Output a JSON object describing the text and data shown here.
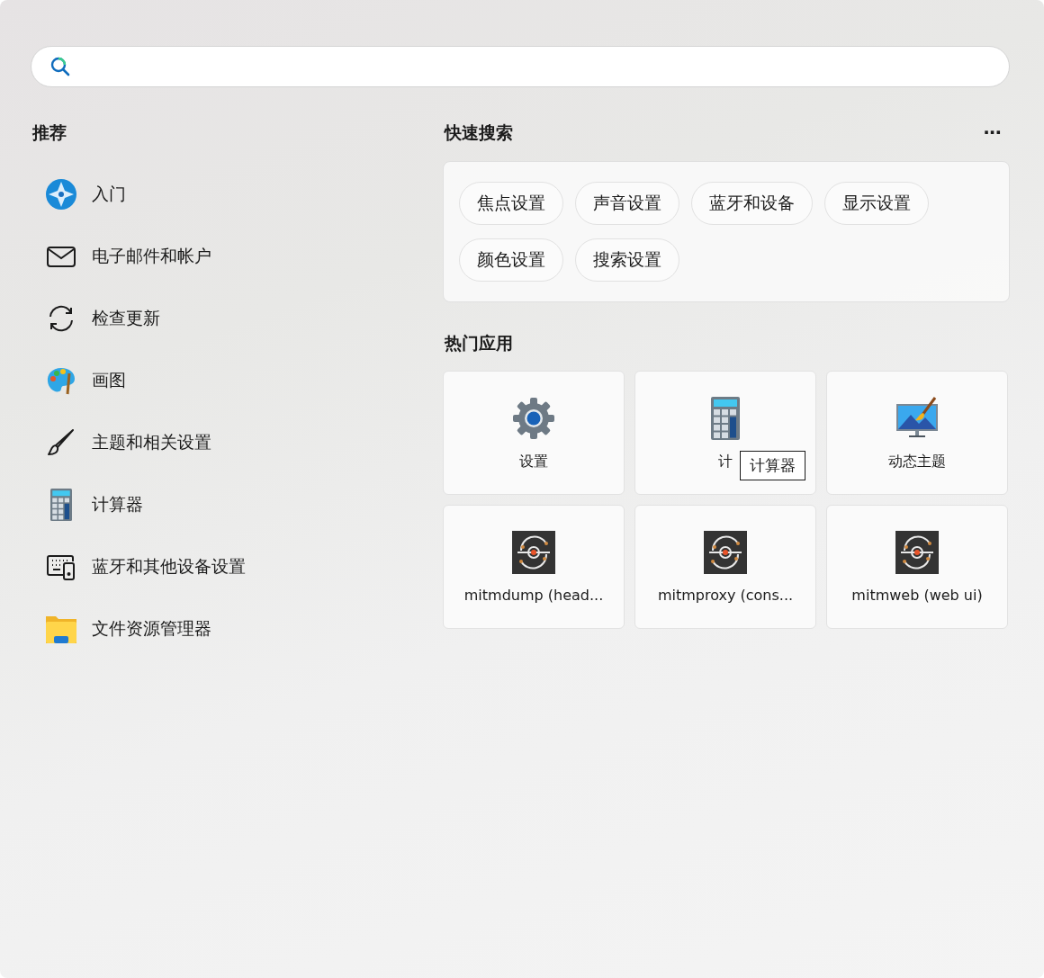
{
  "recommended": {
    "title": "推荐",
    "items": [
      {
        "label": "入门",
        "kind": "tips"
      },
      {
        "label": "电子邮件和帐户",
        "kind": "mail"
      },
      {
        "label": "检查更新",
        "kind": "sync"
      },
      {
        "label": "画图",
        "kind": "paint"
      },
      {
        "label": "主题和相关设置",
        "kind": "brush"
      },
      {
        "label": "计算器",
        "kind": "calculator"
      },
      {
        "label": "蓝牙和其他设备设置",
        "kind": "devices"
      },
      {
        "label": "文件资源管理器",
        "kind": "folder"
      }
    ]
  },
  "quick_search": {
    "title": "快速搜索",
    "more": "···",
    "chips": [
      "焦点设置",
      "声音设置",
      "蓝牙和设备",
      "显示设置",
      "颜色设置",
      "搜索设置"
    ]
  },
  "top_apps": {
    "title": "热门应用",
    "apps": [
      {
        "label": "设置",
        "kind": "gear"
      },
      {
        "label": "计",
        "kind": "calculator",
        "tooltip": "计算器"
      },
      {
        "label": "动态主题",
        "kind": "theme"
      },
      {
        "label": "mitmdump (head...",
        "kind": "mitm"
      },
      {
        "label": "mitmproxy (cons...",
        "kind": "mitm"
      },
      {
        "label": "mitmweb (web ui)",
        "kind": "mitm"
      }
    ]
  }
}
